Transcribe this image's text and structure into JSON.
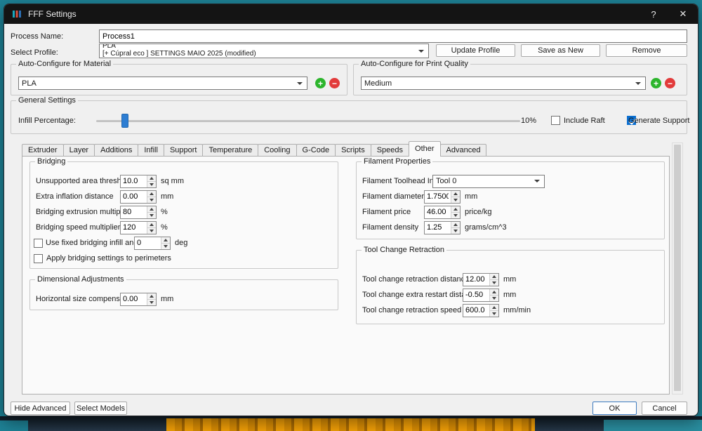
{
  "window": {
    "title": "FFF Settings"
  },
  "icons": {
    "help": "?",
    "close": "✕",
    "add": "+",
    "remove": "−"
  },
  "header": {
    "process_name_label": "Process Name:",
    "process_name_value": "Process1",
    "select_profile_label": "Select Profile:",
    "profile_value_line1": "PLA",
    "profile_value_line2": "[+ Cúpral eco ]  SETTINGS MAIO 2025 (modified)",
    "buttons": {
      "update": "Update Profile",
      "save_as_new": "Save as New",
      "remove": "Remove"
    }
  },
  "auto_material": {
    "title": "Auto-Configure for Material",
    "value": "PLA"
  },
  "auto_quality": {
    "title": "Auto-Configure for Print Quality",
    "value": "Medium"
  },
  "general": {
    "title": "General Settings",
    "infill_label": "Infill Percentage:",
    "infill_percent": "10%",
    "include_raft_label": "Include Raft",
    "include_raft_checked": false,
    "generate_support_label": "Generate Support",
    "generate_support_checked": true
  },
  "tabs": {
    "items": [
      "Extruder",
      "Layer",
      "Additions",
      "Infill",
      "Support",
      "Temperature",
      "Cooling",
      "G-Code",
      "Scripts",
      "Speeds",
      "Other",
      "Advanced"
    ],
    "active": "Other"
  },
  "bridging": {
    "title": "Bridging",
    "rows": [
      {
        "label": "Unsupported area threshold",
        "value": "10.0",
        "unit": "sq mm"
      },
      {
        "label": "Extra inflation distance",
        "value": "0.00",
        "unit": "mm"
      },
      {
        "label": "Bridging extrusion multiplier",
        "value": "80",
        "unit": "%"
      },
      {
        "label": "Bridging speed multiplier",
        "value": "120",
        "unit": "%"
      }
    ],
    "fixed_angle": {
      "label": "Use fixed bridging infill angle",
      "value": "0",
      "unit": "deg",
      "checked": false
    },
    "apply_perimeters": {
      "label": "Apply bridging settings to perimeters",
      "checked": false
    }
  },
  "dimensional": {
    "title": "Dimensional Adjustments",
    "row": {
      "label": "Horizontal size compensation",
      "value": "0.00",
      "unit": "mm"
    }
  },
  "filament": {
    "title": "Filament Properties",
    "toolhead": {
      "label": "Filament Toolhead Index",
      "value": "Tool 0"
    },
    "rows": [
      {
        "label": "Filament diameter",
        "value": "1.7500",
        "unit": "mm"
      },
      {
        "label": "Filament price",
        "value": "46.00",
        "unit": "price/kg"
      },
      {
        "label": "Filament density",
        "value": "1.25",
        "unit": "grams/cm^3"
      }
    ]
  },
  "tool_change": {
    "title": "Tool Change Retraction",
    "rows": [
      {
        "label": "Tool change retraction distance",
        "value": "12.00",
        "unit": "mm"
      },
      {
        "label": "Tool change extra restart distance",
        "value": "-0.50",
        "unit": "mm"
      },
      {
        "label": "Tool change retraction speed",
        "value": "600.0",
        "unit": "mm/min"
      }
    ]
  },
  "footer": {
    "hide_advanced": "Hide Advanced",
    "select_models": "Select Models",
    "ok": "OK",
    "cancel": "Cancel"
  }
}
